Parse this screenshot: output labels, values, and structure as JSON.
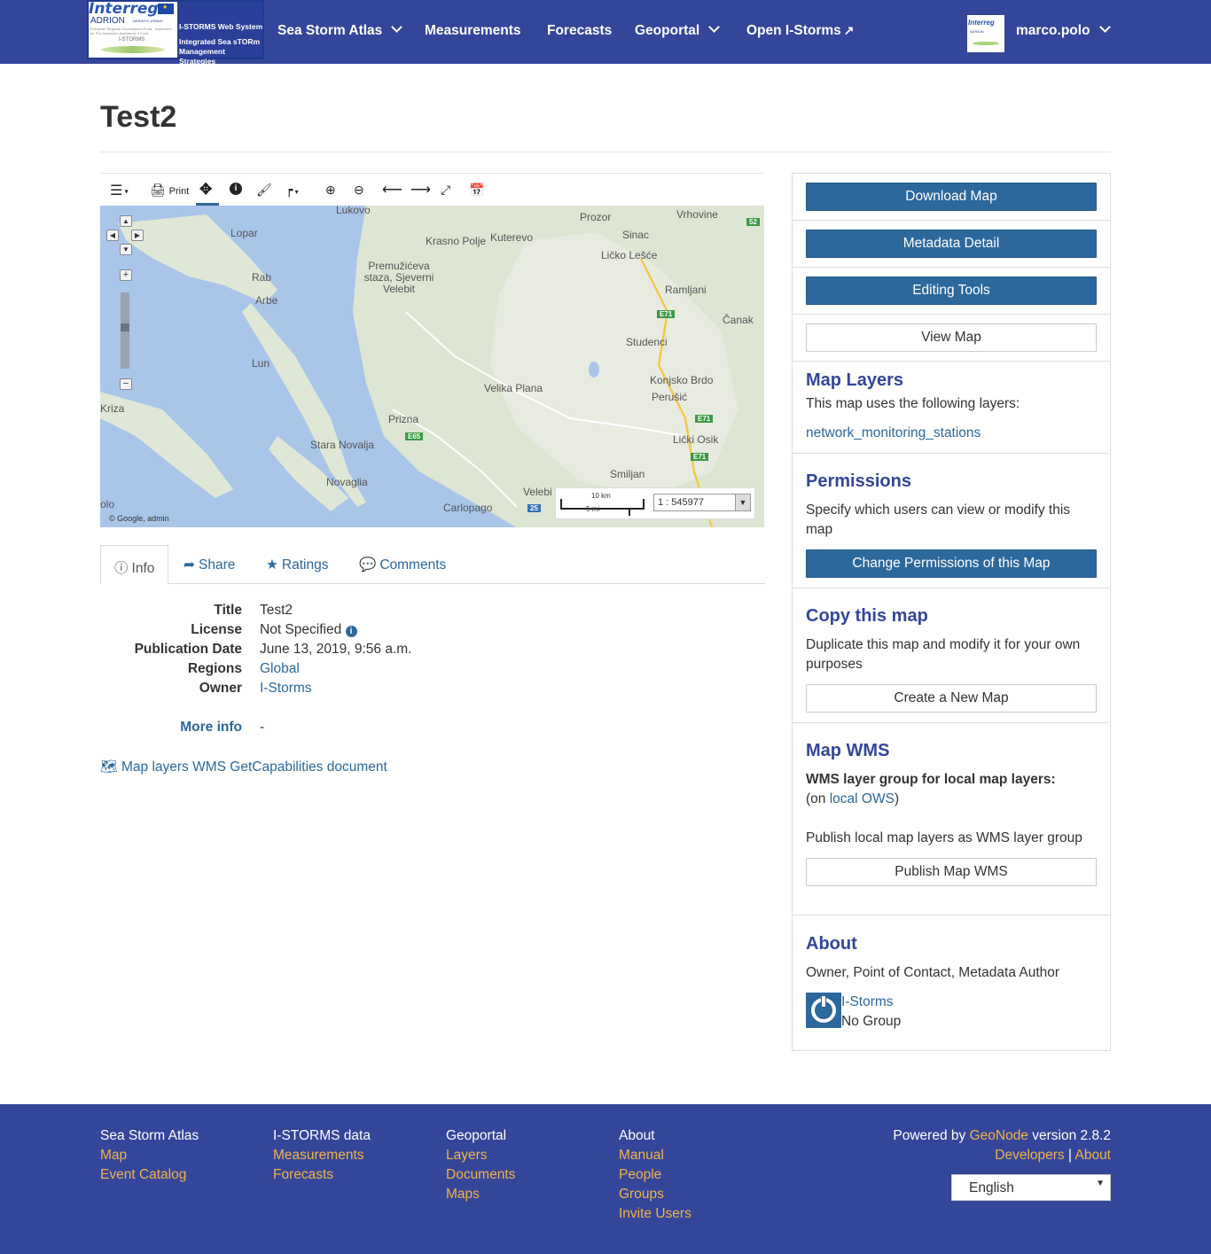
{
  "navbar": {
    "logo": {
      "brand": "Interreg",
      "program": "ADRION",
      "program_sub": "ADRIATIC-IONIAN",
      "tagline": "European Regional Development Fund · Instrument for Pre-Accession Assistance II Fund",
      "project": "I-STORMS",
      "system": "I-STORMS Web System",
      "subtitle": "Integrated Sea sTORm Management Strategies"
    },
    "items": [
      {
        "label": "Sea Storm Atlas",
        "dropdown": true
      },
      {
        "label": "Measurements"
      },
      {
        "label": "Forecasts"
      },
      {
        "label": "Geoportal",
        "dropdown": true
      },
      {
        "label": "Open I-Storms",
        "external": true
      }
    ],
    "user": {
      "name": "marco.polo",
      "avatar_brand": "Interreg",
      "avatar_program": "ADRION"
    }
  },
  "page": {
    "title": "Test2"
  },
  "map": {
    "toolbar": [
      {
        "icon": "layers-menu-icon",
        "label": ""
      },
      {
        "icon": "print-icon",
        "label": "Print"
      },
      {
        "icon": "pan-icon",
        "active": true
      },
      {
        "icon": "info-icon"
      },
      {
        "icon": "draw-icon"
      },
      {
        "icon": "measure-icon"
      },
      {
        "icon": "zoom-in-icon"
      },
      {
        "icon": "zoom-out-icon"
      },
      {
        "icon": "back-arrow-icon"
      },
      {
        "icon": "forward-arrow-icon"
      },
      {
        "icon": "fullscreen-icon"
      },
      {
        "icon": "calendar-icon"
      }
    ],
    "places": [
      "Lukovo",
      "Prozor",
      "Vrhovine",
      "Lopar",
      "Krasno Polje",
      "Kuterevo",
      "Sinac",
      "Ličko Lešće",
      "Premužićeva staza, Sjeverni Velebit",
      "Rab",
      "Arbe",
      "Ramljani",
      "Čanak",
      "Studenci",
      "Lun",
      "Velika Plana",
      "Konjsko Brdo",
      "Perušić",
      "Kriza",
      "Prizna",
      "Lički Osik",
      "Stara Novalja",
      "Novaglia",
      "Smiljan",
      "Velebi",
      "Carlopago",
      "olo"
    ],
    "roads": [
      "52",
      "E71",
      "E71",
      "E71",
      "E65",
      "25"
    ],
    "attribution": "© Google, admin",
    "scale": {
      "km": "10 km",
      "mi": "5 mi",
      "ratio": "1 : 545977"
    }
  },
  "tabs": [
    {
      "label": "Info",
      "icon": "info-circle-icon",
      "active": true
    },
    {
      "label": "Share",
      "icon": "share-icon"
    },
    {
      "label": "Ratings",
      "icon": "star-icon"
    },
    {
      "label": "Comments",
      "icon": "comment-icon"
    }
  ],
  "info": {
    "title_label": "Title",
    "title_value": "Test2",
    "license_label": "License",
    "license_value": "Not Specified",
    "pubdate_label": "Publication Date",
    "pubdate_value": "June 13, 2019, 9:56 a.m.",
    "regions_label": "Regions",
    "regions_value": "Global",
    "owner_label": "Owner",
    "owner_value": "I-Storms",
    "more_label": "More info",
    "more_value": "-",
    "wms_link": "Map layers WMS GetCapabilities document"
  },
  "sidebar": {
    "download": "Download Map",
    "metadata": "Metadata Detail",
    "editing": "Editing Tools",
    "view": "View Map",
    "layers_heading": "Map Layers",
    "layers_text": "This map uses the following layers:",
    "layers": [
      "network_monitoring_stations"
    ],
    "permissions_heading": "Permissions",
    "permissions_text": "Specify which users can view or modify this map",
    "permissions_button": "Change Permissions of this Map",
    "copy_heading": "Copy this map",
    "copy_text": "Duplicate this map and modify it for your own purposes",
    "copy_button": "Create a New Map",
    "wms_heading": "Map WMS",
    "wms_bold": "WMS layer group for local map layers:",
    "wms_on": "(on ",
    "wms_link": "local OWS",
    "wms_close": ")",
    "wms_publish_text": "Publish local map layers as WMS layer group",
    "wms_button": "Publish Map WMS",
    "about_heading": "About",
    "about_roles": "Owner, Point of Contact, Metadata Author",
    "about_user": "I-Storms",
    "about_group": "No Group"
  },
  "footer": {
    "col1": {
      "heading": "Sea Storm Atlas",
      "links": [
        "Map",
        "Event Catalog"
      ]
    },
    "col2": {
      "heading": "I-STORMS data",
      "links": [
        "Measurements",
        "Forecasts"
      ]
    },
    "col3": {
      "heading": "Geoportal",
      "links": [
        "Layers",
        "Documents",
        "Maps"
      ]
    },
    "col4": {
      "heading": "About",
      "links": [
        "Manual",
        "People",
        "Groups",
        "Invite Users"
      ]
    },
    "powered_prefix": "Powered by ",
    "powered_link": "GeoNode",
    "powered_suffix": " version 2.8.2",
    "developers": "Developers",
    "sep": "|",
    "about": "About",
    "language": "English"
  },
  "colors": {
    "nav": "#34469a",
    "primary": "#2c689c",
    "link": "#2c689c",
    "footer_link": "#f0b34a",
    "heading": "#34469a"
  }
}
